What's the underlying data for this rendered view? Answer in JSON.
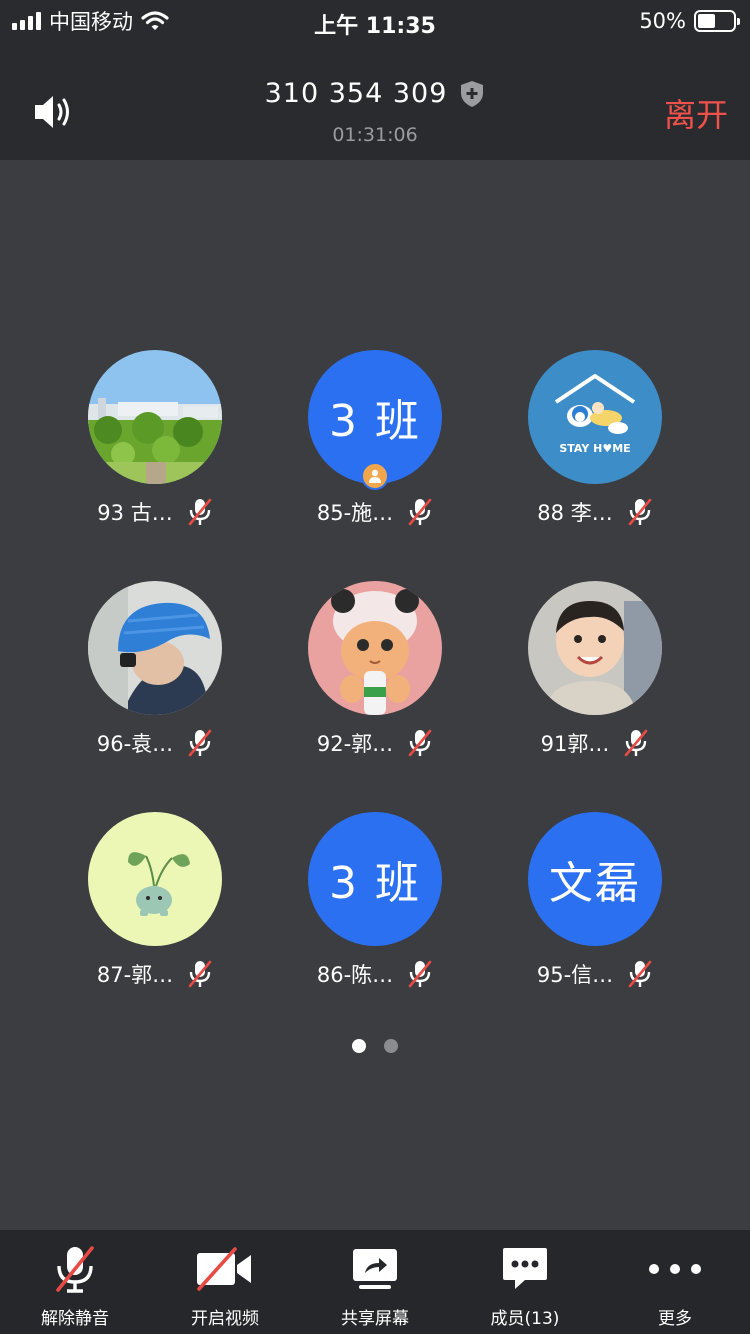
{
  "status_bar": {
    "carrier": "中国移动",
    "time": "上午 11:35",
    "battery": "50%",
    "battery_level": 0.5
  },
  "header": {
    "meeting_id": "310 354 309",
    "duration": "01:31:06",
    "leave_label": "离开",
    "leave_color": "#f0514a"
  },
  "participants": [
    {
      "name": "93 古…",
      "avatar": "campus-photo",
      "mic": "muted"
    },
    {
      "name": "85-施…",
      "avatar_text": "3 班",
      "host": true,
      "mic": "muted"
    },
    {
      "name": "88 李…",
      "avatar": "stay-home-illustration",
      "avatar_caption": "STAY H♥ME",
      "mic": "muted"
    },
    {
      "name": "96-袁…",
      "avatar": "blue-beanie-photo",
      "mic": "muted"
    },
    {
      "name": "92-郭…",
      "avatar": "kitten-photo",
      "mic": "muted"
    },
    {
      "name": "91郭…",
      "avatar": "child-photo",
      "mic": "muted"
    },
    {
      "name": "87-郭…",
      "avatar": "plant-creature-drawing",
      "mic": "muted"
    },
    {
      "name": "86-陈…",
      "avatar_text": "3 班",
      "mic": "muted"
    },
    {
      "name": "95-信…",
      "avatar_text": "文磊",
      "mic": "muted"
    }
  ],
  "pager": {
    "pages": 2,
    "current": 1
  },
  "toolbar": {
    "unmute": "解除静音",
    "video": "开启视频",
    "share": "共享屏幕",
    "members": "成员(13)",
    "more": "更多"
  },
  "colors": {
    "accent": "#2a70f0",
    "background": "#3b3d41",
    "bar": "#2a2b2e",
    "mute_slash": "#e84a44"
  }
}
